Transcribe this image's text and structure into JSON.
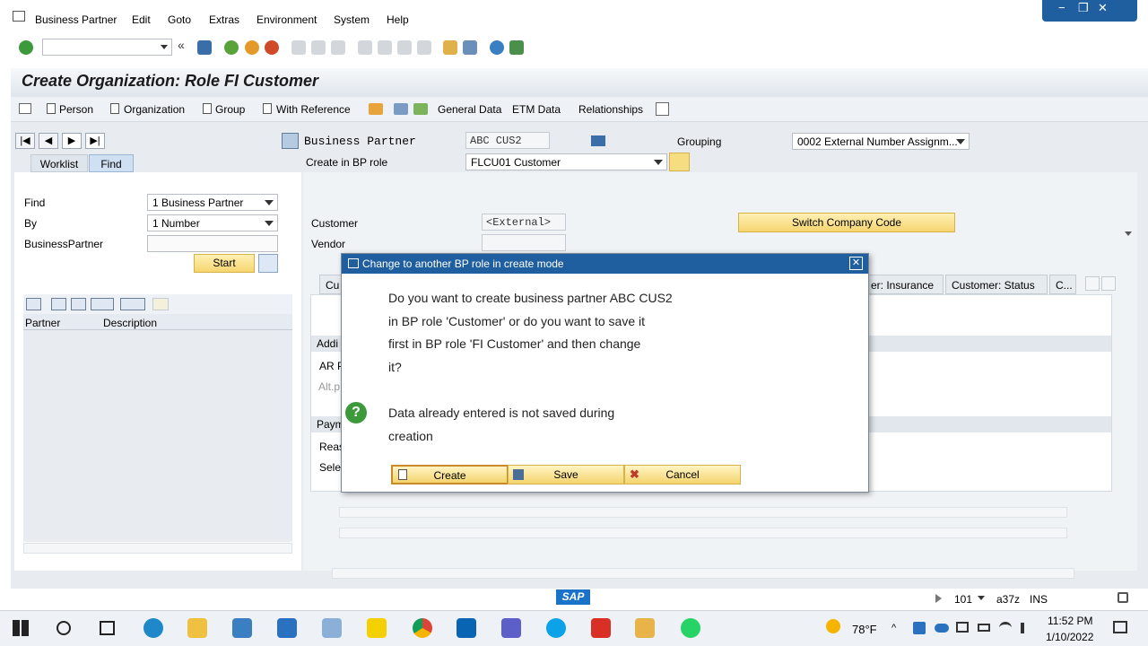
{
  "menu": {
    "items": [
      "Business Partner",
      "Edit",
      "Goto",
      "Extras",
      "Environment",
      "System",
      "Help"
    ]
  },
  "window_controls": {
    "minimize": "−",
    "restore": "❐",
    "close": "✕"
  },
  "page": {
    "title": "Create Organization: Role FI Customer"
  },
  "app_toolbar": {
    "person": "Person",
    "organization": "Organization",
    "group": "Group",
    "with_reference": "With Reference",
    "general_data": "General Data",
    "etm_data": "ETM Data",
    "relationships": "Relationships"
  },
  "left": {
    "tabs": {
      "worklist": "Worklist",
      "find": "Find"
    },
    "find_label": "Find",
    "find_value": "1 Business Partner",
    "by_label": "By",
    "by_value": "1 Number",
    "bp_label": "BusinessPartner",
    "bp_value": "",
    "start_button": "Start",
    "columns": {
      "partner": "Partner",
      "description": "Description"
    }
  },
  "header": {
    "bp_label": "Business Partner",
    "bp_value": "ABC CUS2",
    "grouping_label": "Grouping",
    "grouping_value": "0002 External Number Assignm...",
    "role_label": "Create in BP role",
    "role_value": "FLCU01 Customer"
  },
  "detail": {
    "customer_label": "Customer",
    "customer_value": "<External>",
    "vendor_label": "Vendor",
    "vendor_value": "",
    "switch_company_code": "Switch Company Code",
    "tabs": {
      "first": "Cu",
      "insurance": "er: Insurance",
      "status": "Customer: Status",
      "more": "C..."
    },
    "sections": {
      "addi": "Addi",
      "ar": "AR P",
      "alt": "Alt.p",
      "paym": "Paym",
      "reas": "Reas",
      "sele": "Sele"
    }
  },
  "dialog": {
    "title": "Change to another BP role in create mode",
    "lines": [
      "Do you want to create business partner ABC CUS2",
      "in BP role 'Customer' or do you want to save it",
      "first in BP role 'FI Customer' and then change",
      "it?"
    ],
    "note_lines": [
      "Data already entered is not saved during",
      "creation"
    ],
    "buttons": {
      "create": "Create",
      "save": "Save",
      "cancel": "Cancel"
    }
  },
  "status": {
    "sap_logo": "SAP",
    "client": "101",
    "server": "a37z",
    "mode": "INS"
  },
  "taskbar": {
    "weather": "78°F",
    "time": "11:52 PM",
    "date": "1/10/2022"
  }
}
